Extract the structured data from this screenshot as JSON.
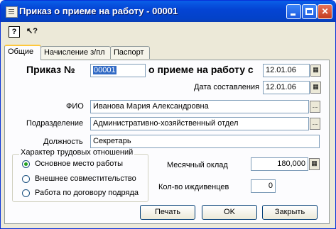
{
  "window": {
    "title": "Приказ о приеме на работу - 00001"
  },
  "titlebar_buttons": {
    "minimize": "_",
    "maximize": "□",
    "close": "✕"
  },
  "toolbar": {
    "help_glyph": "?",
    "whatsthis_glyph": "↖?"
  },
  "tabs": [
    {
      "label": "Общие",
      "active": true
    },
    {
      "label": "Начисление з/пл",
      "active": false
    },
    {
      "label": "Паспорт",
      "active": false
    }
  ],
  "form": {
    "order_label": "Приказ №",
    "order_number": "00001",
    "hire_label": "о приеме на работу с",
    "hire_date": "12.01.06",
    "compose_label": "Дата составления",
    "compose_date": "12.01.06",
    "fio_label": "ФИО",
    "fio_value": "Иванова Мария Александровна",
    "dept_label": "Подразделение",
    "dept_value": "Административно-хозяйственный отдел",
    "position_label": "Должность",
    "position_value": "Секретарь",
    "salary_label": "Месячный оклад",
    "salary_value": "180,000",
    "dependents_label": "Кол-во иждивенцев",
    "dependents_value": "0"
  },
  "relations": {
    "title": "Характер трудовых отношений",
    "options": [
      {
        "label": "Основное место работы",
        "selected": true
      },
      {
        "label": "Внешнее совместительство",
        "selected": false
      },
      {
        "label": "Работа по договору подряда",
        "selected": false
      }
    ]
  },
  "buttons": {
    "print": "Печать",
    "ok": "OK",
    "close": "Закрыть"
  },
  "icons": {
    "calendar": "calendar-icon",
    "ellipsis": "..."
  }
}
